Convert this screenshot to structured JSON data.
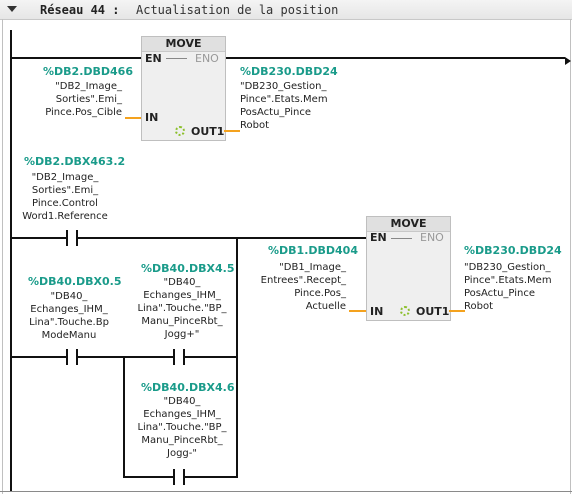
{
  "network": {
    "title": "Réseau 44 :",
    "comment": "Actualisation de la position"
  },
  "move1": {
    "title": "MOVE",
    "en": "EN",
    "eno": "ENO",
    "in": "IN",
    "out1": "OUT1",
    "in_address": "%DB2.DBD466",
    "in_symbol": "\"DB2_Image_\nSorties\".Emi_\nPince.Pos_Cible",
    "out_address": "%DB230.DBD24",
    "out_symbol": "\"DB230_Gestion_\nPince\".Etats.Mem\nPosActu_Pince\nRobot"
  },
  "contact_ref": {
    "address": "%DB2.DBX463.2",
    "symbol": "\"DB2_Image_\nSorties\".Emi_\nPince.Control\nWord1.Reference"
  },
  "contact_bpmode": {
    "address": "%DB40.DBX0.5",
    "symbol": "\"DB40_\nEchanges_IHM_\nLina\".Touche.Bp\nModeManu"
  },
  "contact_jogg_plus": {
    "address": "%DB40.DBX4.5",
    "symbol": "\"DB40_\nEchanges_IHM_\nLina\".Touche.\"BP_\nManu_PinceRbt_\nJogg+\""
  },
  "contact_jogg_minus": {
    "address": "%DB40.DBX4.6",
    "symbol": "\"DB40_\nEchanges_IHM_\nLina\".Touche.\"BP_\nManu_PinceRbt_\nJogg-\""
  },
  "move2": {
    "title": "MOVE",
    "en": "EN",
    "eno": "ENO",
    "in": "IN",
    "out1": "OUT1",
    "in_address": "%DB1.DBD404",
    "in_symbol": "\"DB1_Image_\nEntrees\".Recept_\nPince.Pos_\nActuelle",
    "out_address": "%DB230.DBD24",
    "out_symbol": "\"DB230_Gestion_\nPince\".Etats.Mem\nPosActu_Pince\nRobot"
  },
  "colors": {
    "address": "#1a9b8a",
    "stub": "#f4a21e",
    "block_bg": "#efefef",
    "wire": "#111111"
  }
}
